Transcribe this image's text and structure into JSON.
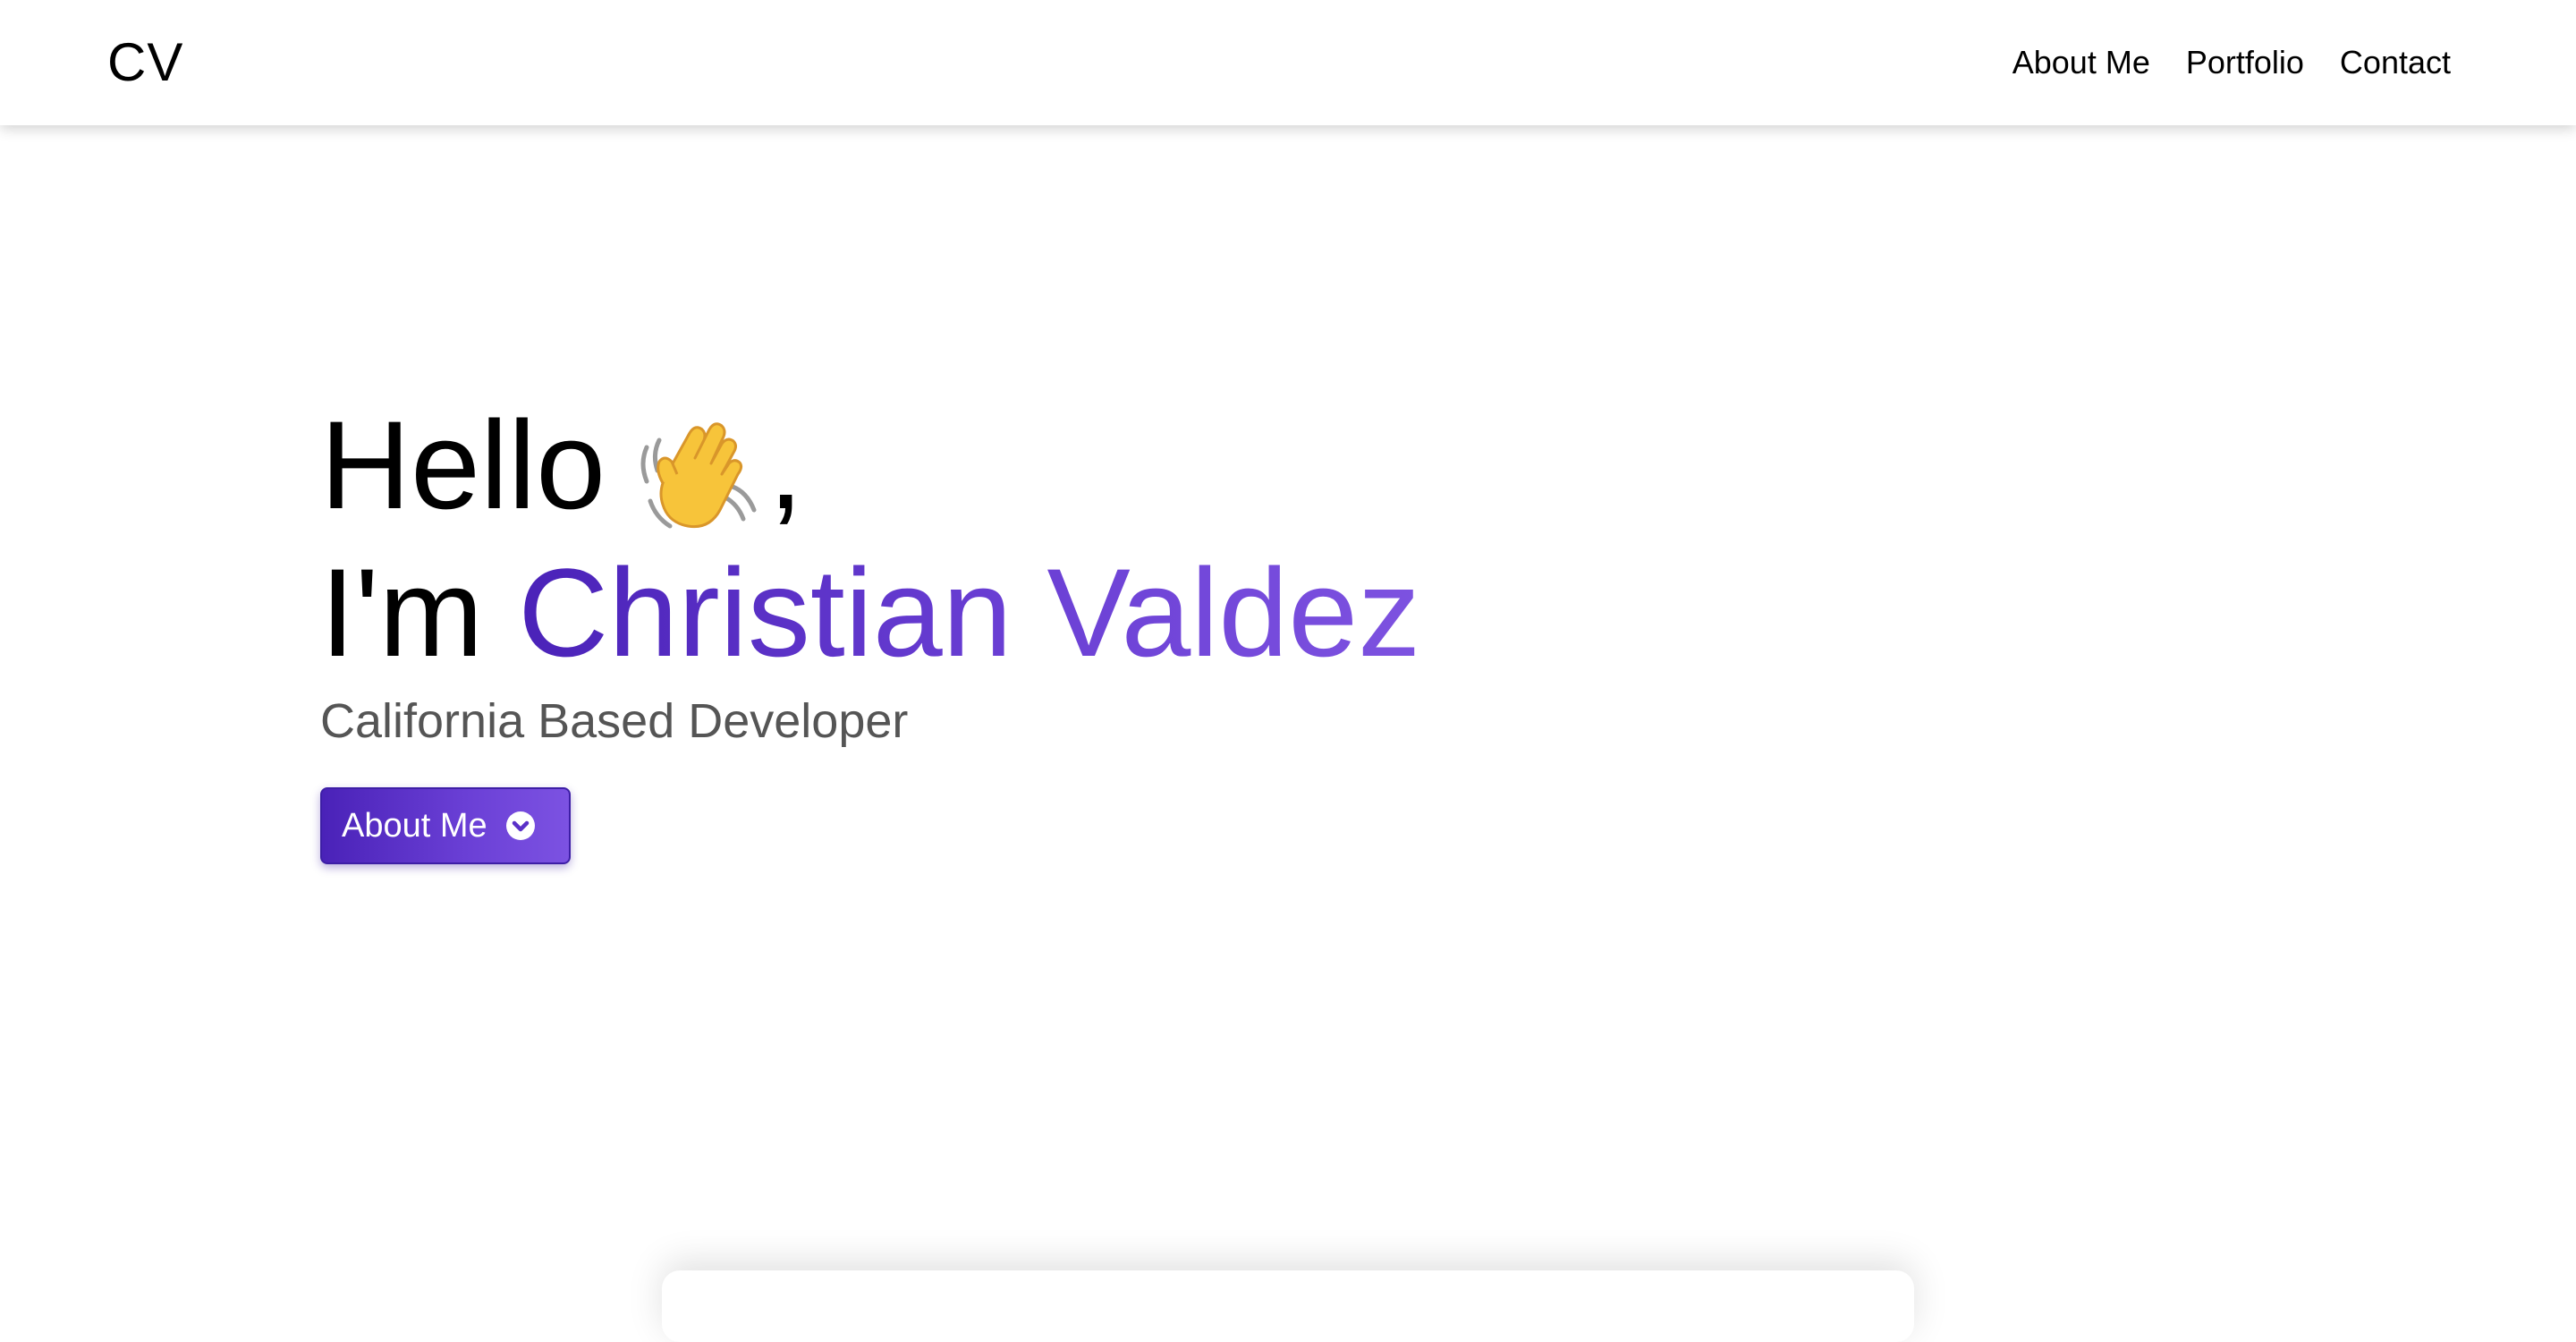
{
  "nav": {
    "logo": "CV",
    "links": [
      "About Me",
      "Portfolio",
      "Contact"
    ]
  },
  "hero": {
    "greeting": "Hello",
    "greeting_emoji": "waving-hand-icon",
    "greeting_suffix": ",",
    "intro_prefix": "I'm",
    "name": "Christian Valdez",
    "subtitle": "California Based Developer"
  },
  "cta": {
    "label": "About Me",
    "icon": "chevron-down-circle-icon"
  },
  "colors": {
    "accent_start": "#4a22b8",
    "accent_end": "#7d52e0",
    "subtitle": "#555555"
  }
}
